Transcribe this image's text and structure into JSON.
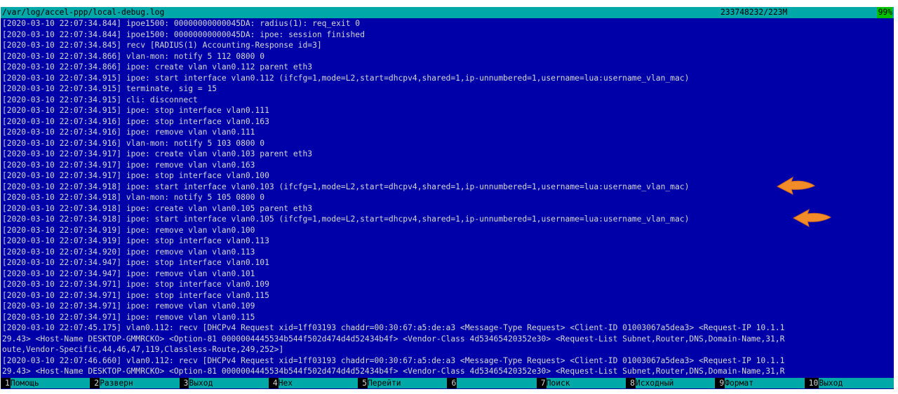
{
  "window": {
    "file_path": "/var/log/accel-ppp/local-debug.log",
    "file_size": "233748232/223M",
    "percent": "99%"
  },
  "log_lines": [
    "[2020-03-10 22:07:34.844] ipoe1500: 00000000000045DA: radius(1): req_exit 0",
    "[2020-03-10 22:07:34.844] ipoe1500: 00000000000045DA: ipoe: session finished",
    "[2020-03-10 22:07:34.845] recv [RADIUS(1) Accounting-Response id=3]",
    "[2020-03-10 22:07:34.866] vlan-mon: notify 5 112 0800 0",
    "[2020-03-10 22:07:34.866] ipoe: create vlan vlan0.112 parent eth3",
    "[2020-03-10 22:07:34.915] ipoe: start interface vlan0.112 (ifcfg=1,mode=L2,start=dhcpv4,shared=1,ip-unnumbered=1,username=lua:username_vlan_mac)",
    "[2020-03-10 22:07:34.915] terminate, sig = 15",
    "[2020-03-10 22:07:34.915] cli: disconnect",
    "[2020-03-10 22:07:34.915] ipoe: stop interface vlan0.111",
    "[2020-03-10 22:07:34.916] ipoe: stop interface vlan0.163",
    "[2020-03-10 22:07:34.916] ipoe: remove vlan vlan0.111",
    "[2020-03-10 22:07:34.916] vlan-mon: notify 5 103 0800 0",
    "[2020-03-10 22:07:34.917] ipoe: create vlan vlan0.103 parent eth3",
    "[2020-03-10 22:07:34.917] ipoe: remove vlan vlan0.163",
    "[2020-03-10 22:07:34.917] ipoe: stop interface vlan0.100",
    "[2020-03-10 22:07:34.918] ipoe: start interface vlan0.103 (ifcfg=1,mode=L2,start=dhcpv4,shared=1,ip-unnumbered=1,username=lua:username_vlan_mac)",
    "[2020-03-10 22:07:34.918] vlan-mon: notify 5 105 0800 0",
    "[2020-03-10 22:07:34.918] ipoe: create vlan vlan0.105 parent eth3",
    "[2020-03-10 22:07:34.918] ipoe: start interface vlan0.105 (ifcfg=1,mode=L2,start=dhcpv4,shared=1,ip-unnumbered=1,username=lua:username_vlan_mac)",
    "[2020-03-10 22:07:34.919] ipoe: remove vlan vlan0.100",
    "[2020-03-10 22:07:34.919] ipoe: stop interface vlan0.113",
    "[2020-03-10 22:07:34.920] ipoe: remove vlan vlan0.113",
    "[2020-03-10 22:07:34.947] ipoe: stop interface vlan0.101",
    "[2020-03-10 22:07:34.947] ipoe: remove vlan vlan0.101",
    "[2020-03-10 22:07:34.971] ipoe: stop interface vlan0.109",
    "[2020-03-10 22:07:34.971] ipoe: stop interface vlan0.115",
    "[2020-03-10 22:07:34.971] ipoe: remove vlan vlan0.109",
    "[2020-03-10 22:07:34.971] ipoe: remove vlan vlan0.115",
    "[2020-03-10 22:07:45.175] vlan0.112: recv [DHCPv4 Request xid=1ff03193 chaddr=00:30:67:a5:de:a3 <Message-Type Request> <Client-ID 01003067a5dea3> <Request-IP 10.1.1",
    "29.43> <Host-Name DESKTOP-GMMRCKO> <Option-81 0000004445534b544f502d474d4d52434b4f> <Vendor-Class 4d53465420352e30> <Request-List Subnet,Router,DNS,Domain-Name,31,R",
    "oute,Vendor-Specific,44,46,47,119,Classless-Route,249,252>]",
    "[2020-03-10 22:07:46.660] vlan0.112: recv [DHCPv4 Request xid=1ff03193 chaddr=00:30:67:a5:de:a3 <Message-Type Request> <Client-ID 01003067a5dea3> <Request-IP 10.1.1",
    "29.43> <Host-Name DESKTOP-GMMRCKO> <Option-81 0000004445534b544f502d474d4d52434b4f> <Vendor-Class 4d53465420352e30> <Request-List Subnet,Router,DNS,Domain-Name,31,R"
  ],
  "function_keys": [
    {
      "num": "1",
      "label": "Помощь"
    },
    {
      "num": "2",
      "label": "Разверн"
    },
    {
      "num": "3",
      "label": "Выход"
    },
    {
      "num": "4",
      "label": "Hex"
    },
    {
      "num": "5",
      "label": "Перейти"
    },
    {
      "num": "6",
      "label": ""
    },
    {
      "num": "7",
      "label": "Поиск"
    },
    {
      "num": "8",
      "label": "Исходный"
    },
    {
      "num": "9",
      "label": "Формат"
    },
    {
      "num": "10",
      "label": "Выход"
    }
  ],
  "colors": {
    "background": "#0000a8",
    "text": "#d6d6d6",
    "bar": "#00a8a8",
    "percent_highlight": "#00c000",
    "annotation_arrow": "#f28c28"
  },
  "annotations": [
    {
      "icon": "orange-arrow-icon",
      "points_to_line": 16
    },
    {
      "icon": "orange-arrow-icon",
      "points_to_line": 19
    }
  ]
}
